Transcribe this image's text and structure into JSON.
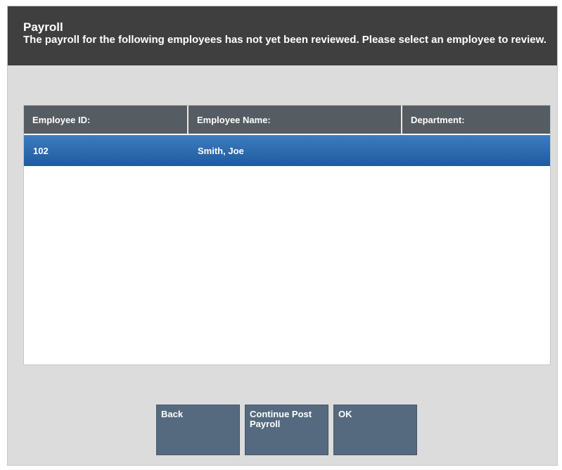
{
  "header": {
    "title": "Payroll",
    "message": "The payroll for the following employees has not yet been reviewed. Please select an employee to review."
  },
  "table": {
    "columns": [
      "Employee ID:",
      "Employee Name:",
      "Department:"
    ],
    "rows": [
      {
        "id": "102",
        "name": "Smith, Joe",
        "department": ""
      }
    ]
  },
  "buttons": {
    "back": "Back",
    "continue_post": "Continue Post Payroll",
    "ok": "OK"
  },
  "colors": {
    "header_bg": "#3f3f3f",
    "window_bg": "#dcdcdc",
    "table_header_bg": "#555d63",
    "selected_row": "#2a68ad",
    "button_bg": "#556a7f"
  }
}
